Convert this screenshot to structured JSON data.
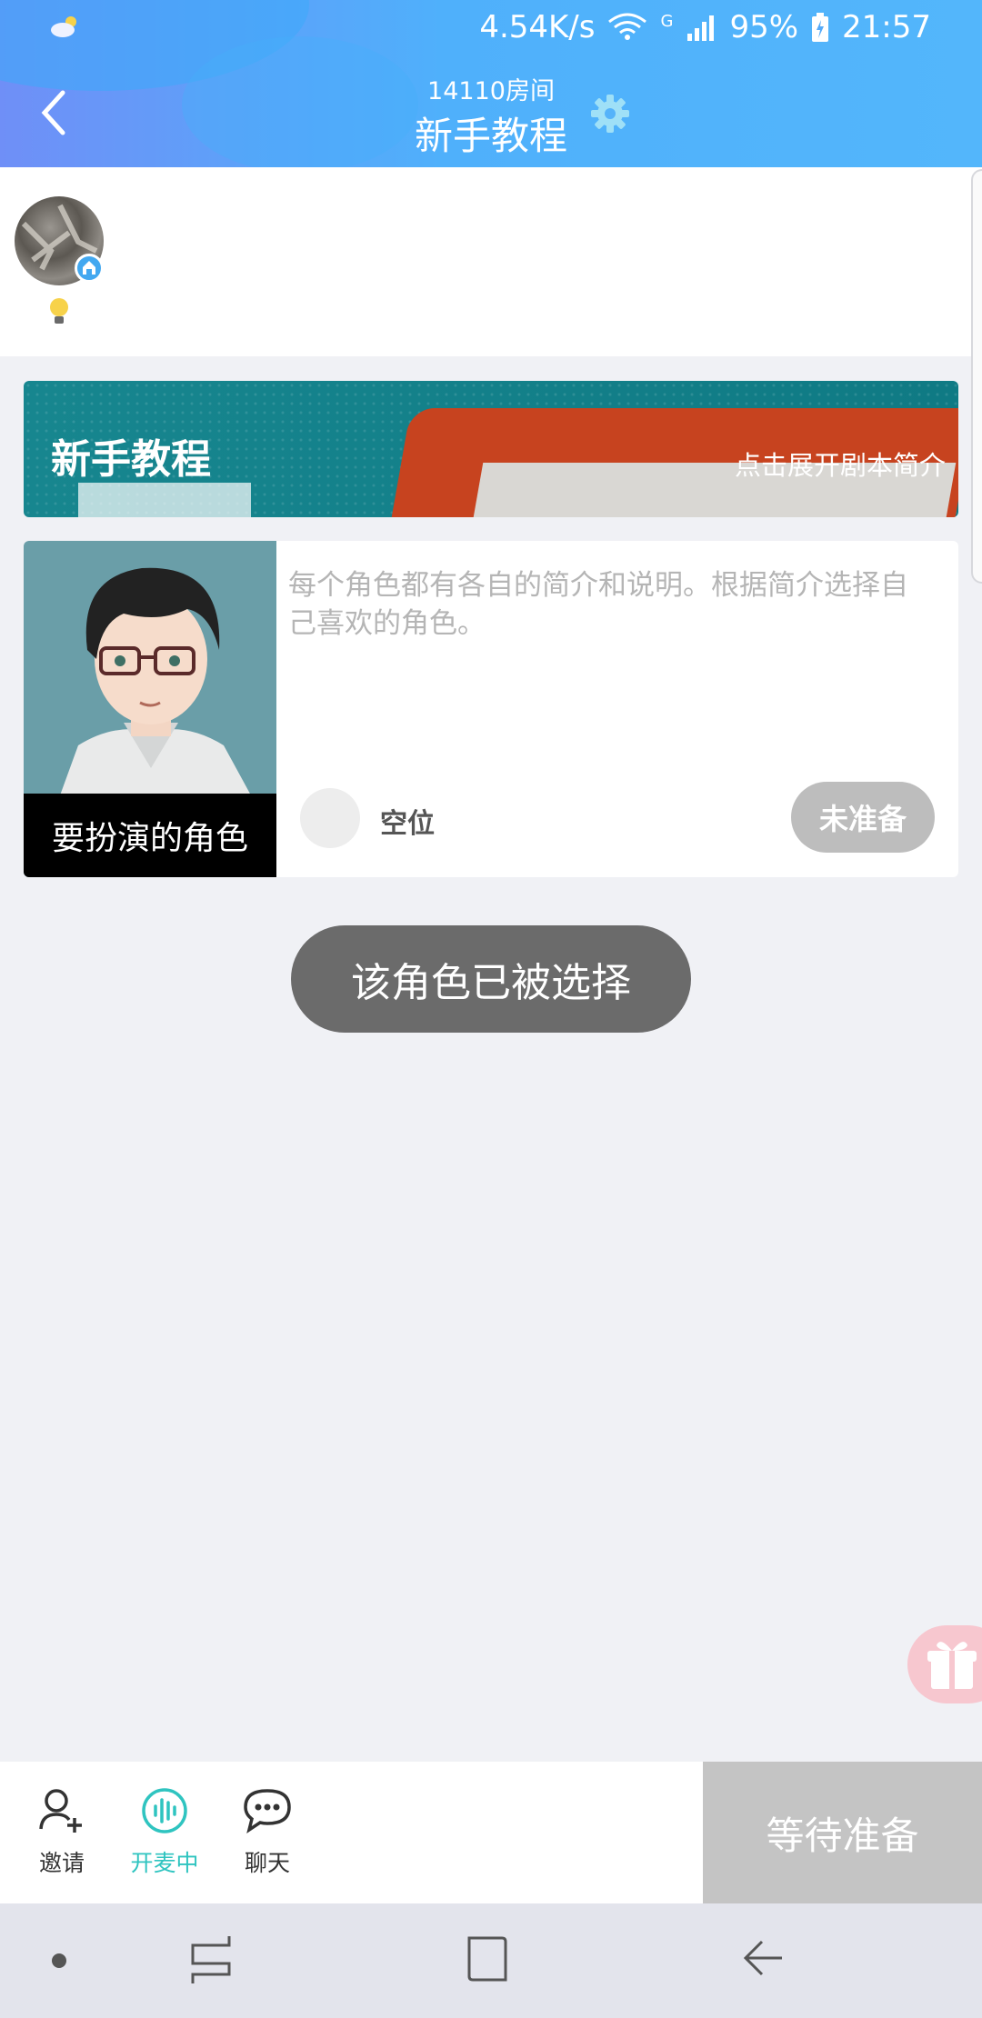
{
  "status_bar": {
    "speed": "4.54K/s",
    "network": "G",
    "battery": "95%",
    "time": "21:57"
  },
  "header": {
    "room_number": "14110房间",
    "title": "新手教程"
  },
  "banner": {
    "title": "新手教程",
    "link": "点击展开剧本简介"
  },
  "role_card": {
    "image_caption": "要扮演的角色",
    "description": "每个角色都有各自的简介和说明。根据简介选择自己喜欢的角色。",
    "slot_label": "空位",
    "ready_status": "未准备"
  },
  "toast": "该角色已被选择",
  "bottom_bar": {
    "tools": [
      {
        "label": "邀请",
        "icon": "invite-icon"
      },
      {
        "label": "开麦中",
        "icon": "mic-on-icon"
      },
      {
        "label": "聊天",
        "icon": "chat-icon"
      }
    ],
    "action": "等待准备"
  },
  "colors": {
    "accent": "#2fc4c0",
    "header_start": "#6f8ff7",
    "header_end": "#53b6fb",
    "banner": "#17868f"
  }
}
